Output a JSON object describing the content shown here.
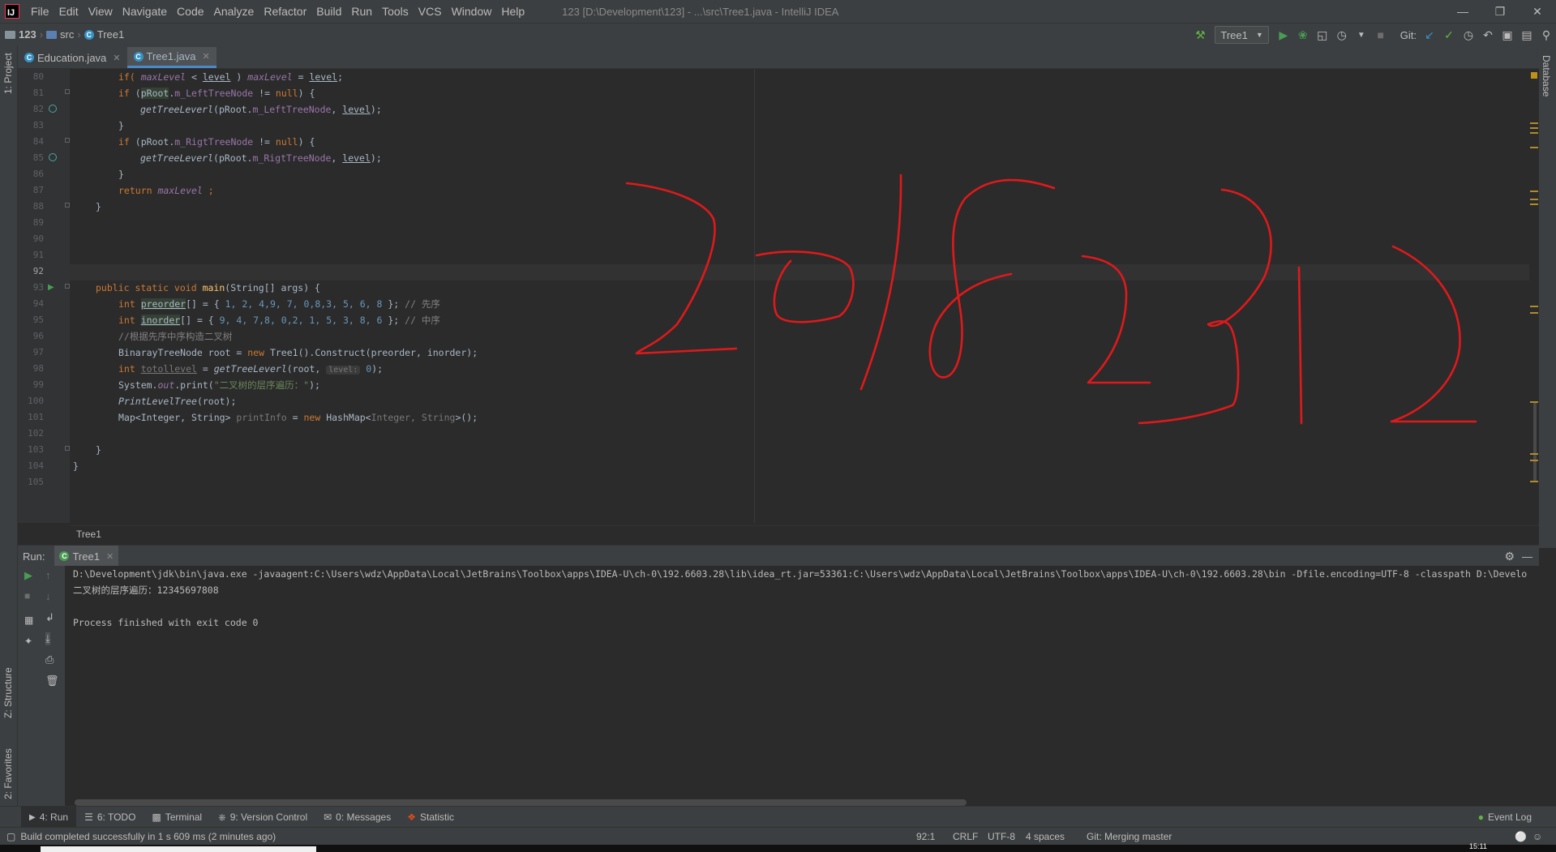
{
  "app": {
    "title": "123 [D:\\Development\\123] - ...\\src\\Tree1.java - IntelliJ IDEA",
    "logo": "IJ",
    "menu": [
      "File",
      "Edit",
      "View",
      "Navigate",
      "Code",
      "Analyze",
      "Refactor",
      "Build",
      "Run",
      "Tools",
      "VCS",
      "Window",
      "Help"
    ]
  },
  "nav": {
    "project": "123",
    "folder": "src",
    "file": "Tree1",
    "run_config": "Tree1",
    "git_label": "Git:"
  },
  "left_tool": {
    "project": "1: Project",
    "structure": "Z: Structure",
    "favorites": "2: Favorites"
  },
  "right_tool": {
    "database": "Database"
  },
  "tabs": [
    {
      "label": "Education.java"
    },
    {
      "label": "Tree1.java"
    }
  ],
  "editor": {
    "line_numbers": [
      "80",
      "81",
      "82",
      "83",
      "84",
      "85",
      "86",
      "87",
      "88",
      "89",
      "90",
      "91",
      "92",
      "93",
      "94",
      "95",
      "96",
      "97",
      "98",
      "99",
      "100",
      "101",
      "102",
      "103",
      "104",
      "105"
    ],
    "breadcrumb": "Tree1",
    "lines": {
      "l80": {
        "t1": "if( ",
        "v1": "maxLevel",
        "t2": " < ",
        "v2": "level",
        "t3": " ) ",
        "v3": "maxLevel",
        "t4": " = ",
        "v4": "level",
        "t5": ";"
      },
      "l81": {
        "k": "if",
        "t1": " (",
        "v1": "pRoot",
        "t2": ".",
        "f1": "m_LeftTreeNode",
        "t3": " != ",
        "k2": "null",
        "t4": ") {"
      },
      "l82": {
        "fn": "getTreeLeverl",
        "t1": "(pRoot.",
        "f1": "m_LeftTreeNode",
        "t2": ", ",
        "v1": "level",
        "t3": ");"
      },
      "l83": {
        "t1": "}"
      },
      "l84": {
        "k": "if",
        "t1": " (pRoot.",
        "f1": "m_RigtTreeNode",
        "t2": " != ",
        "k2": "null",
        "t3": ") {"
      },
      "l85": {
        "fn": "getTreeLeverl",
        "t1": "(pRoot.",
        "f1": "m_RigtTreeNode",
        "t2": ", ",
        "v1": "level",
        "t3": ");"
      },
      "l86": {
        "t1": "}"
      },
      "l87": {
        "k": "return",
        "v1": " maxLevel",
        "t1": " ;"
      },
      "l88": {
        "t1": "}"
      },
      "l93": {
        "k": "public static void ",
        "fn": "main",
        "t1": "(String[] args) {"
      },
      "l94": {
        "k": "int ",
        "v1": "preorder",
        "t1": "[] = { ",
        "n": "1, 2, 4,9, 7, 0,8,3, 5, 6, 8",
        "t2": " }; ",
        "c": "// 先序"
      },
      "l95": {
        "k": "int ",
        "v1": "inorder",
        "t1": "[] = { ",
        "n": "9, 4, 7,8, 0,2, 1, 5, 3, 8, 6",
        "t2": " }; ",
        "c": "// 中序"
      },
      "l96": {
        "c": "//根据先序中序构造二叉树"
      },
      "l97": {
        "t1": "BinarayTreeNode root = ",
        "k": "new ",
        "t2": "Tree1().Construct(preorder, inorder);"
      },
      "l98": {
        "k": "int ",
        "v1": "totollevel",
        "t1": " = ",
        "fn": "getTreeLeverl",
        "t2": "(root, ",
        "hint": "level:",
        "n": " 0",
        "t3": ");"
      },
      "l99": {
        "t1": "System.",
        "f1": "out",
        "t2": ".print(",
        "s": "\"二叉树的层序遍历：\"",
        "t3": ");"
      },
      "l100": {
        "fn": "PrintLevelTree",
        "t1": "(root);"
      },
      "l101": {
        "t1": "Map<Integer, String> ",
        "v1": "printInfo",
        "t2": " = ",
        "k": "new ",
        "t3": "HashMap<",
        "g": "Integer, String",
        "t4": ">();"
      },
      "l103": {
        "t1": "}"
      },
      "l104": {
        "t1": "}"
      }
    }
  },
  "handwriting": {
    "text": "20182312"
  },
  "run": {
    "label": "Run:",
    "tab": "Tree1",
    "output": [
      "D:\\Development\\jdk\\bin\\java.exe -javaagent:C:\\Users\\wdz\\AppData\\Local\\JetBrains\\Toolbox\\apps\\IDEA-U\\ch-0\\192.6603.28\\lib\\idea_rt.jar=53361:C:\\Users\\wdz\\AppData\\Local\\JetBrains\\Toolbox\\apps\\IDEA-U\\ch-0\\192.6603.28\\bin -Dfile.encoding=UTF-8 -classpath D:\\Develo",
      "二叉树的层序遍历：12345697808",
      "",
      "Process finished with exit code 0"
    ]
  },
  "bottom_tabs": [
    "4: Run",
    "6: TODO",
    "Terminal",
    "9: Version Control",
    "0: Messages",
    "Statistic"
  ],
  "event_log": "Event Log",
  "status": {
    "message": "Build completed successfully in 1 s 609 ms (2 minutes ago)",
    "position": "92:1",
    "line_sep": "CRLF",
    "encoding": "UTF-8",
    "indent": "4 spaces",
    "git": "Git: Merging master"
  },
  "taskbar": {
    "time": "15:11"
  },
  "colors": {
    "accent": "#4a88c7",
    "ink": "#e0191b",
    "run_green": "#499c54"
  }
}
